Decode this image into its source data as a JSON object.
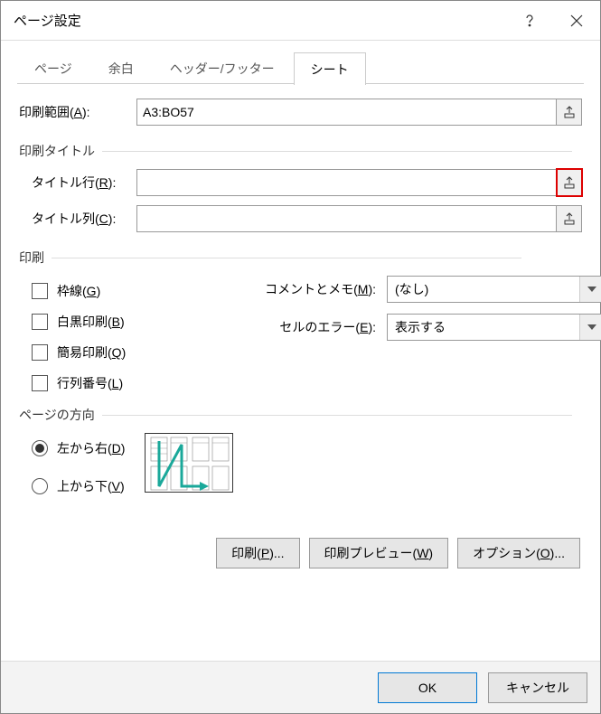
{
  "title": "ページ設定",
  "tabs": [
    "ページ",
    "余白",
    "ヘッダー/フッター",
    "シート"
  ],
  "activeTab": "シート",
  "printArea": {
    "label": "印刷範囲(",
    "accel": "A",
    "labelEnd": "):",
    "value": "A3:BO57"
  },
  "printTitles": {
    "group": "印刷タイトル",
    "rows": {
      "label": "タイトル行(",
      "accel": "R",
      "labelEnd": "):",
      "value": ""
    },
    "cols": {
      "label": "タイトル列(",
      "accel": "C",
      "labelEnd": "):",
      "value": ""
    }
  },
  "printGroup": {
    "group": "印刷",
    "gridlines": {
      "label": "枠線(",
      "accel": "G",
      "labelEnd": ")"
    },
    "blackwhite": {
      "label": "白黒印刷(",
      "accel": "B",
      "labelEnd": ")"
    },
    "draft": {
      "label": "簡易印刷(",
      "accel": "Q",
      "labelEnd": ")"
    },
    "rowcol": {
      "label": "行列番号(",
      "accel": "L",
      "labelEnd": ")"
    },
    "comments": {
      "label": "コメントとメモ(",
      "accel": "M",
      "labelEnd": "):",
      "value": "(なし)"
    },
    "errors": {
      "label": "セルのエラー(",
      "accel": "E",
      "labelEnd": "):",
      "value": "表示する"
    }
  },
  "orderGroup": {
    "group": "ページの方向",
    "ltr": {
      "label": "左から右(",
      "accel": "D",
      "labelEnd": ")",
      "selected": true
    },
    "ttb": {
      "label": "上から下(",
      "accel": "V",
      "labelEnd": ")",
      "selected": false
    }
  },
  "actions": {
    "print": {
      "label": "印刷(",
      "accel": "P",
      "labelEnd": ")..."
    },
    "preview": {
      "label": "印刷プレビュー(",
      "accel": "W",
      "labelEnd": ")"
    },
    "options": {
      "label": "オプション(",
      "accel": "O",
      "labelEnd": ")..."
    }
  },
  "footer": {
    "ok": "OK",
    "cancel": "キャンセル"
  }
}
